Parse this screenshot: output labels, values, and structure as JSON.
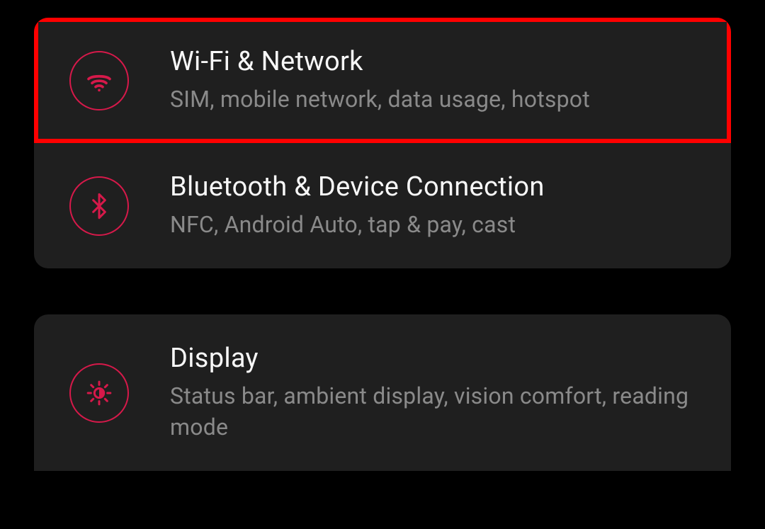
{
  "colors": {
    "accent": "#d6194a",
    "background": "#000000",
    "card": "#1f1f1f",
    "highlight_border": "#ff0000",
    "text_primary": "#f7f7f7",
    "text_secondary": "#8a8a8a"
  },
  "settings_groups": [
    {
      "items": [
        {
          "icon": "wifi-icon",
          "title": "Wi-Fi & Network",
          "subtitle": "SIM, mobile network, data usage, hotspot",
          "highlighted": true
        },
        {
          "icon": "bluetooth-icon",
          "title": "Bluetooth & Device Connection",
          "subtitle": "NFC, Android Auto, tap & pay, cast",
          "highlighted": false
        }
      ]
    },
    {
      "items": [
        {
          "icon": "brightness-icon",
          "title": "Display",
          "subtitle": "Status bar, ambient display, vision comfort, reading mode",
          "highlighted": false
        }
      ]
    }
  ]
}
